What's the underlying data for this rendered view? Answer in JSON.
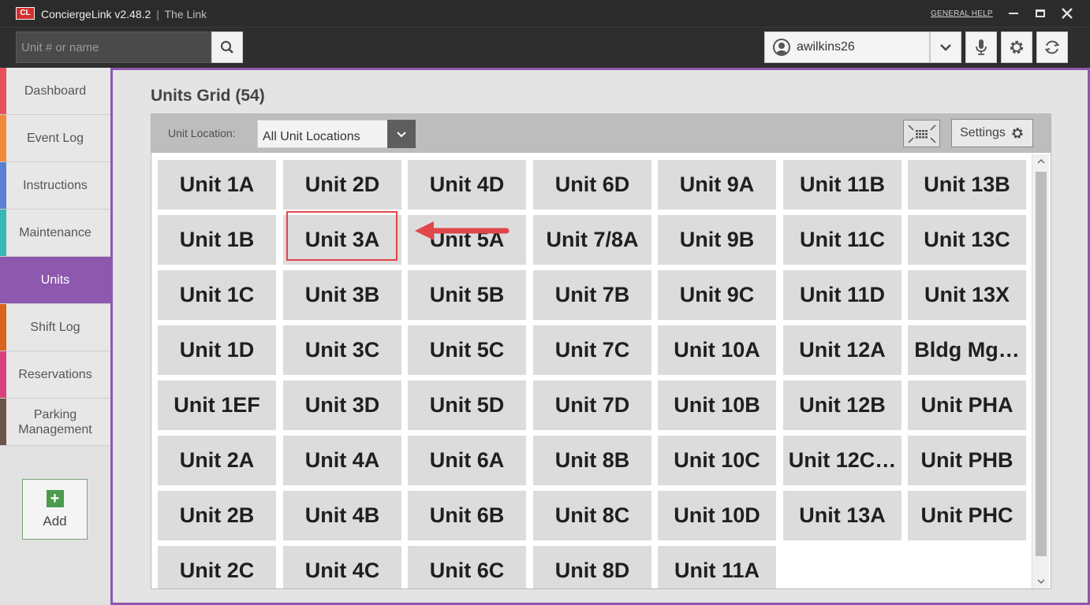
{
  "titlebar": {
    "logo": "CL",
    "app_name": "ConciergeLink v2.48.2",
    "separator": "|",
    "subtitle": "The Link",
    "help_link": "GENERAL HELP"
  },
  "toolbar": {
    "search_placeholder": "Unit # or name",
    "username": "awilkins26"
  },
  "sidebar": {
    "items": [
      {
        "label": "Dashboard",
        "color": "#e8505b"
      },
      {
        "label": "Event Log",
        "color": "#f08a3a"
      },
      {
        "label": "Instructions",
        "color": "#5a7fd6"
      },
      {
        "label": "Maintenance",
        "color": "#36b8b4"
      },
      {
        "label": "Units",
        "color": "#8e58ae"
      },
      {
        "label": "Shift Log",
        "color": "#d9651c"
      },
      {
        "label": "Reservations",
        "color": "#d8417a"
      },
      {
        "label": "Parking Management",
        "color": "#6b5448"
      }
    ],
    "active": "Units",
    "add_label": "Add",
    "add_icon": "+"
  },
  "main": {
    "title": "Units Grid (54)",
    "location_label": "Unit Location:",
    "location_value": "All Unit Locations",
    "settings_label": "Settings",
    "highlighted_unit": "Unit 3A"
  },
  "units": [
    [
      "Unit 1A",
      "Unit 1B",
      "Unit 1C",
      "Unit 1D",
      "Unit 1EF",
      "Unit 2A",
      "Unit 2B",
      "Unit 2C"
    ],
    [
      "Unit 2D",
      "Unit 3A",
      "Unit 3B",
      "Unit 3C",
      "Unit 3D",
      "Unit 4A",
      "Unit 4B",
      "Unit 4C"
    ],
    [
      "Unit 4D",
      "Unit 5A",
      "Unit 5B",
      "Unit 5C",
      "Unit 5D",
      "Unit 6A",
      "Unit 6B",
      "Unit 6C"
    ],
    [
      "Unit 6D",
      "Unit 7/8A",
      "Unit 7B",
      "Unit 7C",
      "Unit 7D",
      "Unit 8B",
      "Unit 8C",
      "Unit 8D"
    ],
    [
      "Unit 9A",
      "Unit 9B",
      "Unit 9C",
      "Unit 10A",
      "Unit 10B",
      "Unit 10C",
      "Unit 10D",
      "Unit 11A"
    ],
    [
      "Unit 11B",
      "Unit 11C",
      "Unit 11D",
      "Unit 12A",
      "Unit 12B",
      "Unit 12C…",
      "Unit 13A"
    ],
    [
      "Unit 13B",
      "Unit 13C",
      "Unit 13X",
      "Bldg Mg…",
      "Unit PHA",
      "Unit PHB",
      "Unit PHC"
    ]
  ],
  "colors": {
    "accent": "#8e58ae",
    "annotation": "#e0464a"
  }
}
